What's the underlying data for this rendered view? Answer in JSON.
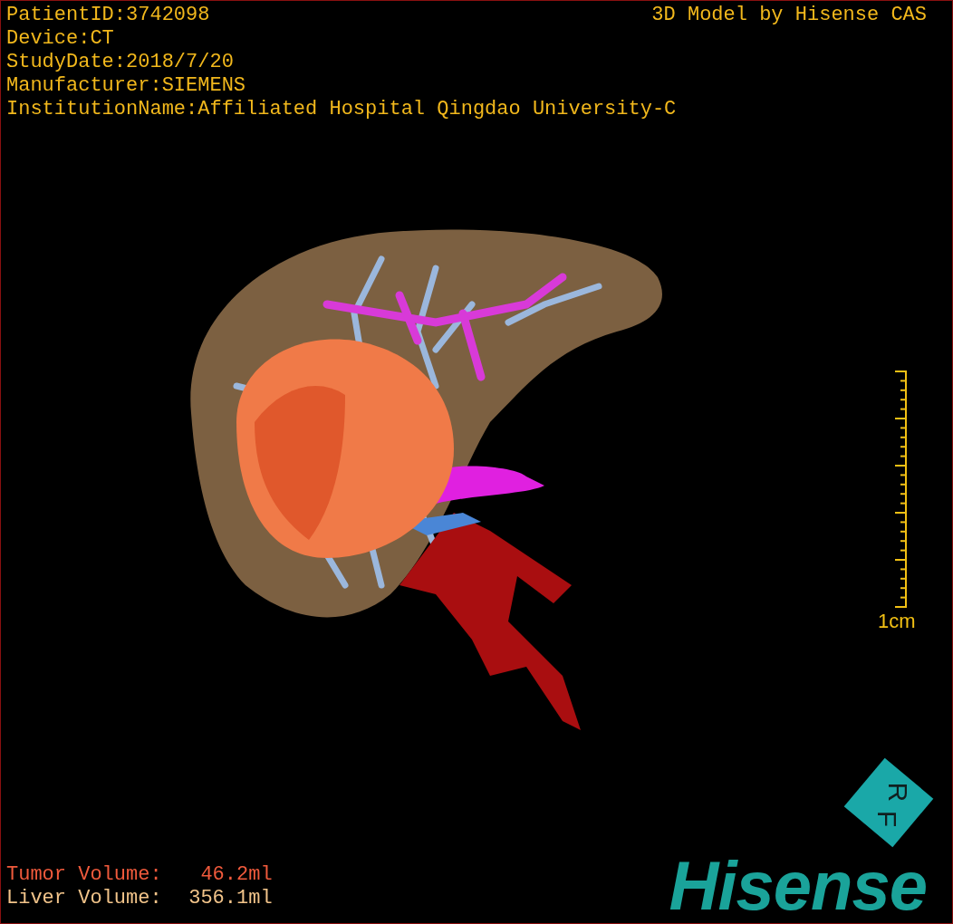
{
  "header": {
    "info_lines": [
      "PatientID:3742098",
      "Device:CT",
      "StudyDate:2018/7/20",
      "Manufacturer:SIEMENS",
      "InstitutionName:Affiliated Hospital Qingdao University-C"
    ],
    "credit": "3D Model by Hisense CAS"
  },
  "scale_bar": {
    "label": "1cm"
  },
  "orientation_cube": {
    "labels": [
      "R",
      "F"
    ]
  },
  "volumes": [
    {
      "label": "Tumor Volume:",
      "value": "46.2ml",
      "color": "#f05a3c"
    },
    {
      "label": "Liver Volume:",
      "value": "356.1ml",
      "color": "#f2c48a"
    }
  ],
  "logo": "Hisense"
}
